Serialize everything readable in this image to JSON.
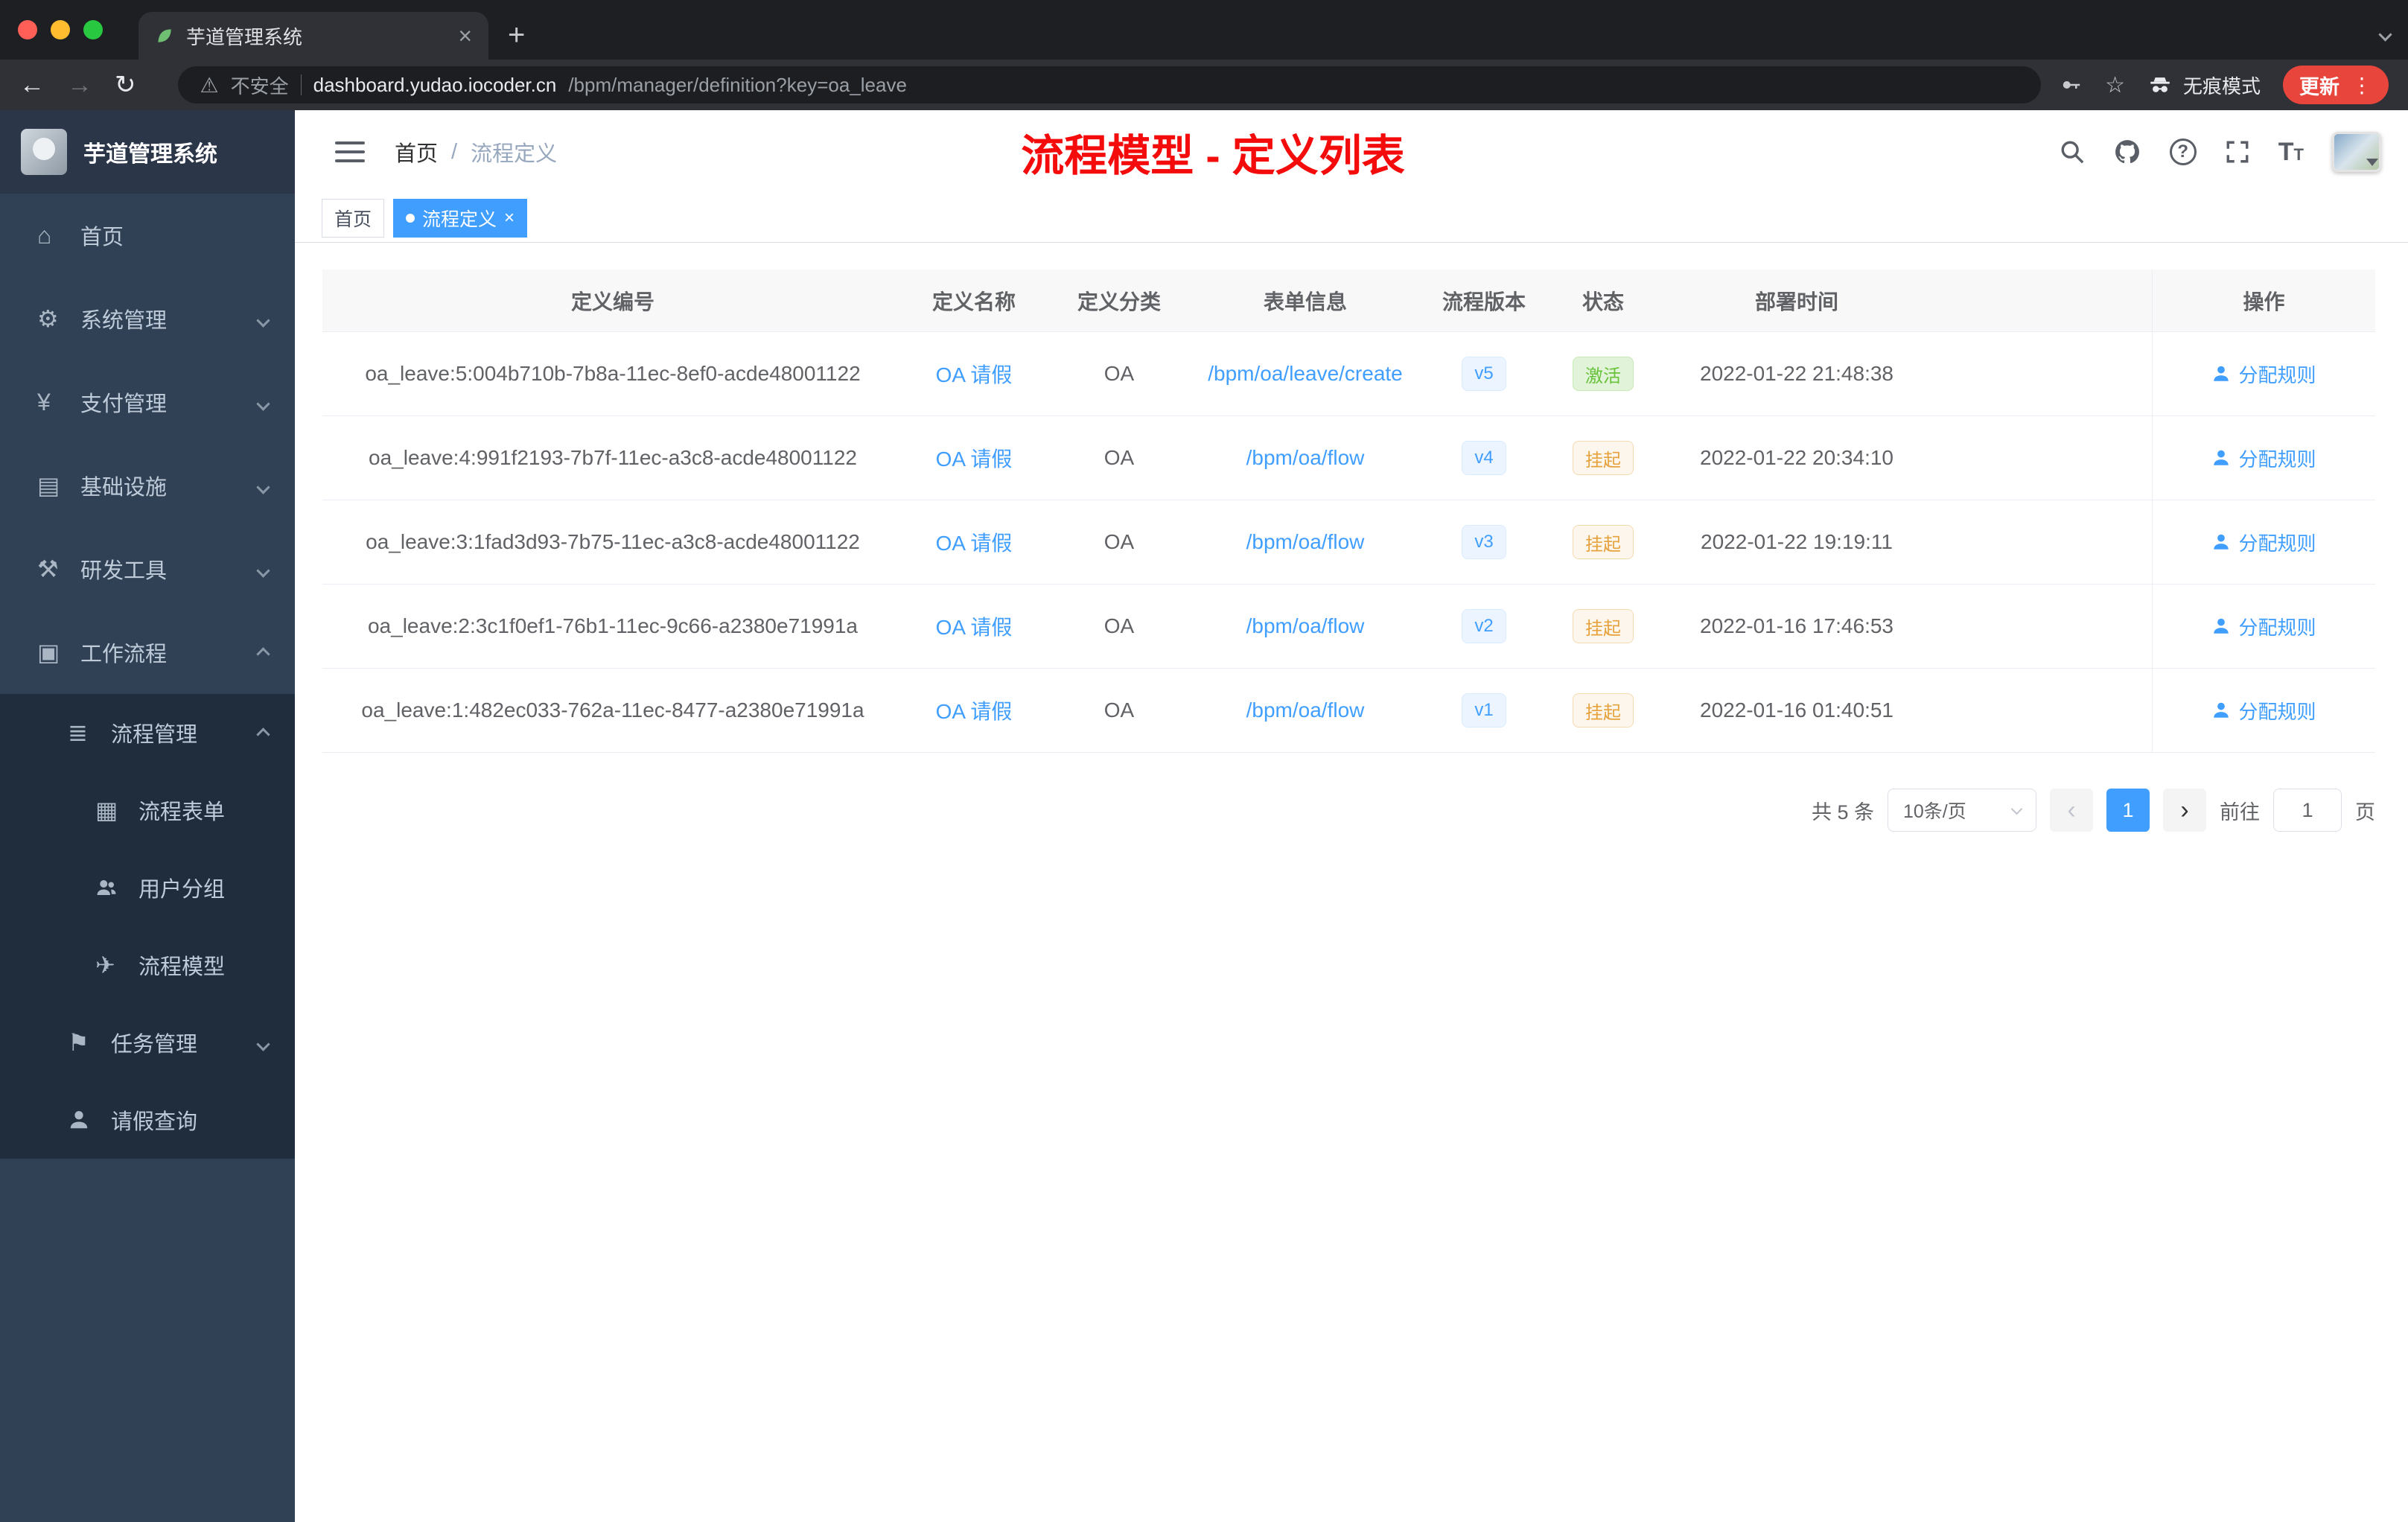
{
  "colors": {
    "accent": "#409eff",
    "success": "#67c23a",
    "warning": "#e6a23c",
    "annotation_red": "#f40b0b",
    "sidebar_bg": "#304156"
  },
  "browser": {
    "tab": {
      "title": "芋道管理系统"
    },
    "address": {
      "security": "不安全",
      "url_host": "dashboard.yudao.iocoder.cn",
      "url_path": "/bpm/manager/definition?key=oa_leave",
      "incognito": "无痕模式",
      "update": "更新"
    }
  },
  "sidebar": {
    "logo_title": "芋道管理系统",
    "items": [
      {
        "label": "首页"
      },
      {
        "label": "系统管理"
      },
      {
        "label": "支付管理"
      },
      {
        "label": "基础设施"
      },
      {
        "label": "研发工具"
      },
      {
        "label": "工作流程"
      }
    ],
    "submenu": {
      "process_mgmt": {
        "label": "流程管理"
      },
      "process_form": {
        "label": "流程表单"
      },
      "user_group": {
        "label": "用户分组"
      },
      "process_model": {
        "label": "流程模型"
      },
      "task_mgmt": {
        "label": "任务管理"
      },
      "leave_query": {
        "label": "请假查询"
      }
    }
  },
  "header": {
    "breadcrumb": {
      "first": "首页",
      "separator": "/",
      "current": "流程定义"
    },
    "annotation": "流程模型 - 定义列表"
  },
  "tags": [
    {
      "label": "首页",
      "active": false
    },
    {
      "label": "流程定义",
      "active": true
    }
  ],
  "table": {
    "headers": [
      "定义编号",
      "定义名称",
      "定义分类",
      "表单信息",
      "流程版本",
      "状态",
      "部署时间",
      "操作"
    ],
    "rows": [
      {
        "id": "oa_leave:5:004b710b-7b8a-11ec-8ef0-acde48001122",
        "name": "OA 请假",
        "category": "OA",
        "form": "/bpm/oa/leave/create",
        "version": "v5",
        "status": "激活",
        "deployed": "2022-01-22 21:48:38",
        "action": "分配规则"
      },
      {
        "id": "oa_leave:4:991f2193-7b7f-11ec-a3c8-acde48001122",
        "name": "OA 请假",
        "category": "OA",
        "form": "/bpm/oa/flow",
        "version": "v4",
        "status": "挂起",
        "deployed": "2022-01-22 20:34:10",
        "action": "分配规则"
      },
      {
        "id": "oa_leave:3:1fad3d93-7b75-11ec-a3c8-acde48001122",
        "name": "OA 请假",
        "category": "OA",
        "form": "/bpm/oa/flow",
        "version": "v3",
        "status": "挂起",
        "deployed": "2022-01-22 19:19:11",
        "action": "分配规则"
      },
      {
        "id": "oa_leave:2:3c1f0ef1-76b1-11ec-9c66-a2380e71991a",
        "name": "OA 请假",
        "category": "OA",
        "form": "/bpm/oa/flow",
        "version": "v2",
        "status": "挂起",
        "deployed": "2022-01-16 17:46:53",
        "action": "分配规则"
      },
      {
        "id": "oa_leave:1:482ec033-762a-11ec-8477-a2380e71991a",
        "name": "OA 请假",
        "category": "OA",
        "form": "/bpm/oa/flow",
        "version": "v1",
        "status": "挂起",
        "deployed": "2022-01-16 01:40:51",
        "action": "分配规则"
      }
    ]
  },
  "pagination": {
    "total": "共 5 条",
    "page_size": "10条/页",
    "current": "1",
    "goto": "前往",
    "goto_value": "1",
    "unit": "页"
  }
}
